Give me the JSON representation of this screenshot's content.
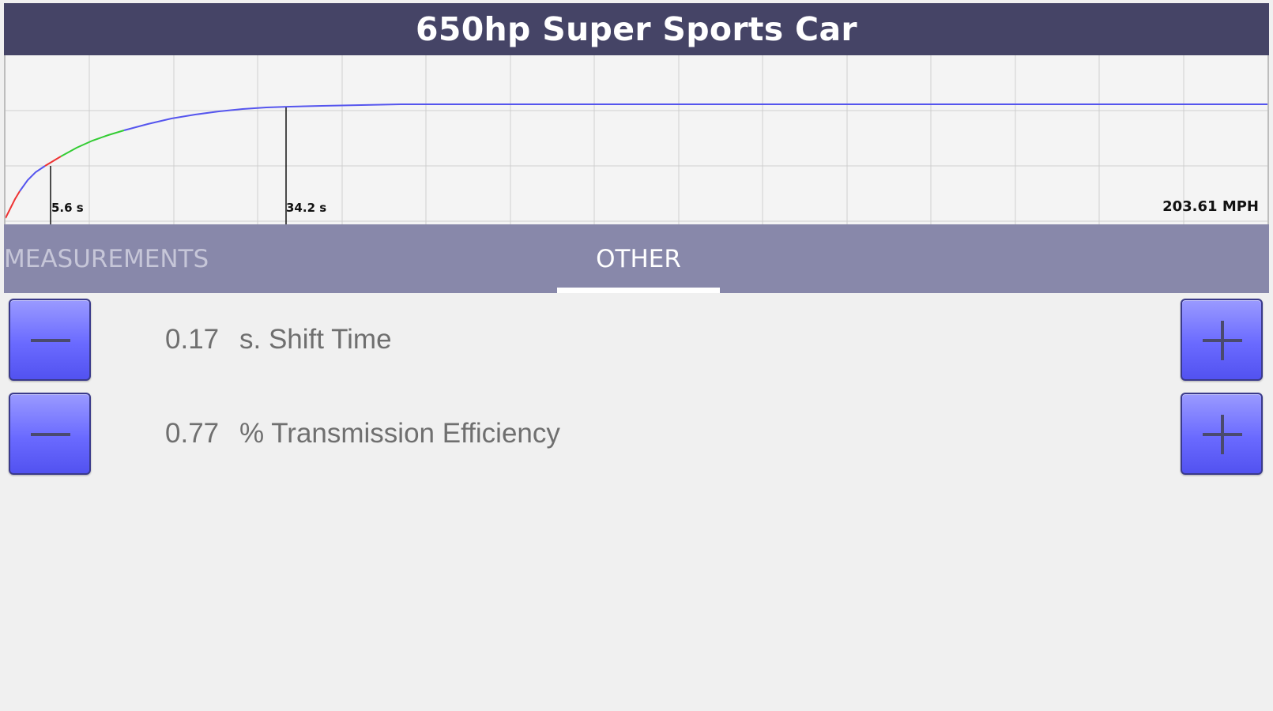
{
  "title": "650hp Super Sports Car",
  "graph": {
    "marker_labels": [
      "5.6 s",
      "34.2 s"
    ],
    "top_speed_label": "203.61 MPH",
    "colors": {
      "grid": "#cfcfcf",
      "curve_start": "#ee3333",
      "curve_mid": "#33cc33",
      "curve_main": "#5555ee",
      "marker": "#111111"
    }
  },
  "tabs": [
    {
      "label": "MEASUREMENTS",
      "active": false
    },
    {
      "label": "OTHER",
      "active": true
    }
  ],
  "settings": [
    {
      "value": "0.17",
      "label": "s. Shift Time",
      "minus_icon": "minus-icon",
      "plus_icon": "plus-icon"
    },
    {
      "value": "0.77",
      "label": "% Transmission Efficiency",
      "minus_icon": "minus-icon",
      "plus_icon": "plus-icon"
    }
  ],
  "colors": {
    "title_bar": "#454466",
    "tab_bar": "#8888aa",
    "button": "#6a6aff",
    "background": "#f0f0f0"
  }
}
